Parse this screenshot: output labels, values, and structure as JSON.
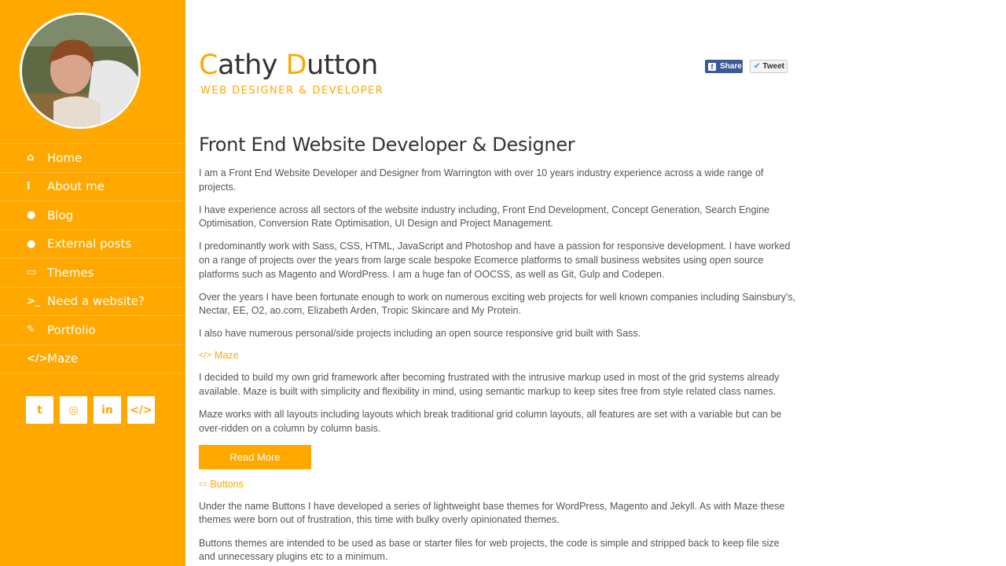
{
  "sidebar": {
    "nav": [
      {
        "icon": "home-icon",
        "glyph": "⌂",
        "label": "Home"
      },
      {
        "icon": "info-icon",
        "glyph": "i",
        "label": "About me"
      },
      {
        "icon": "speech-bubble-icon",
        "glyph": "●",
        "label": "Blog"
      },
      {
        "icon": "speech-bubble-icon",
        "glyph": "●",
        "label": "External posts"
      },
      {
        "icon": "monitor-icon",
        "glyph": "▭",
        "label": "Themes"
      },
      {
        "icon": "terminal-icon",
        "glyph": ">_",
        "label": "Need a website?"
      },
      {
        "icon": "pencil-icon",
        "glyph": "✎",
        "label": "Portfolio"
      },
      {
        "icon": "code-icon",
        "glyph": "</>",
        "label": "Maze"
      }
    ],
    "social": [
      {
        "icon": "twitter-icon",
        "glyph": "t"
      },
      {
        "icon": "github-icon",
        "glyph": "◎"
      },
      {
        "icon": "linkedin-icon",
        "glyph": "in"
      },
      {
        "icon": "code-icon",
        "glyph": "</>"
      }
    ]
  },
  "header": {
    "name_first_cap": "C",
    "name_first_rest": "athy ",
    "name_last_cap": "D",
    "name_last_rest": "utton",
    "tagline": "WEB DESIGNER & DEVELOPER",
    "share_label": "Share",
    "tweet_label": "Tweet"
  },
  "main": {
    "heading": "Front End Website Developer & Designer",
    "intro": [
      "I am a Front End Website Developer and Designer from Warrington with over 10 years industry experience across a wide range of projects.",
      "I have experience across all sectors of the website industry including, Front End Development, Concept Generation, Search Engine Optimisation, Conversion Rate Optimisation, UI Design and Project Management.",
      "I predominantly work with Sass, CSS, HTML, JavaScript and Photoshop and have a passion for responsive development. I have worked on a range of projects over the years from large scale bespoke Ecomerce platforms to small business websites using open source platforms such as Magento and WordPress. I am a huge fan of OOCSS, as well as Git, Gulp and Codepen.",
      "Over the years I have been fortunate enough to work on numerous exciting web projects for well known companies including Sainsbury's, Nectar, EE, O2, ao.com, Elizabeth Arden, Tropic Skincare and My Protein.",
      "I also have numerous personal/side projects including an open source responsive grid built with Sass."
    ],
    "maze": {
      "link": "Maze",
      "paragraphs": [
        "I decided to build my own grid framework after becoming frustrated with the intrusive markup used in most of the grid systems already available. Maze is built with simplicity and flexibility in mind, using semantic markup to keep sites free from style related class names.",
        "Maze works with all layouts including layouts which break traditional grid column layouts, all features are set with a variable but can be over-ridden on a column by column basis."
      ],
      "button": "Read More"
    },
    "buttons": {
      "link": "Buttons",
      "paragraphs": [
        "Under the name Buttons I have developed a series of lightweight base themes for WordPress, Magento and Jekyll. As with Maze these themes were born out of frustration, this time with bulky overly opinionated themes.",
        "Buttons themes are intended to be used as base or starter files for web projects, the code is simple and stripped back to keep file size and unnecessary plugins etc to a minimum."
      ]
    }
  },
  "colors": {
    "accent": "#ffa800",
    "facebook": "#3b5998",
    "twitter": "#55acee"
  }
}
